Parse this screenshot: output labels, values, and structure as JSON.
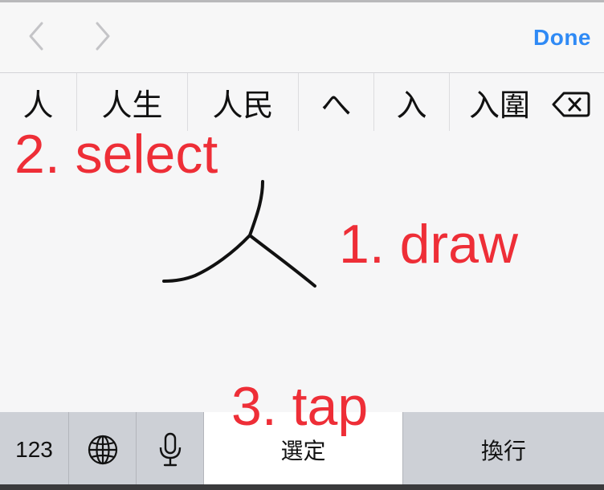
{
  "toolbar": {
    "back_icon": "chevron-left-icon",
    "forward_icon": "chevron-right-icon",
    "done_label": "Done",
    "accent_color": "#2f8af5"
  },
  "candidates": {
    "items": [
      "人",
      "人生",
      "人民",
      "へ",
      "入",
      "入圍"
    ],
    "delete_icon": "backspace-icon"
  },
  "annotations": {
    "select": "2. select",
    "draw": "1. draw",
    "tap": "3. tap",
    "color": "#ee2e37"
  },
  "handwriting": {
    "character": "人"
  },
  "keyboard": {
    "numbers_label": "123",
    "globe_icon": "globe-icon",
    "mic_icon": "microphone-icon",
    "select_label": "選定",
    "return_label": "換行"
  }
}
